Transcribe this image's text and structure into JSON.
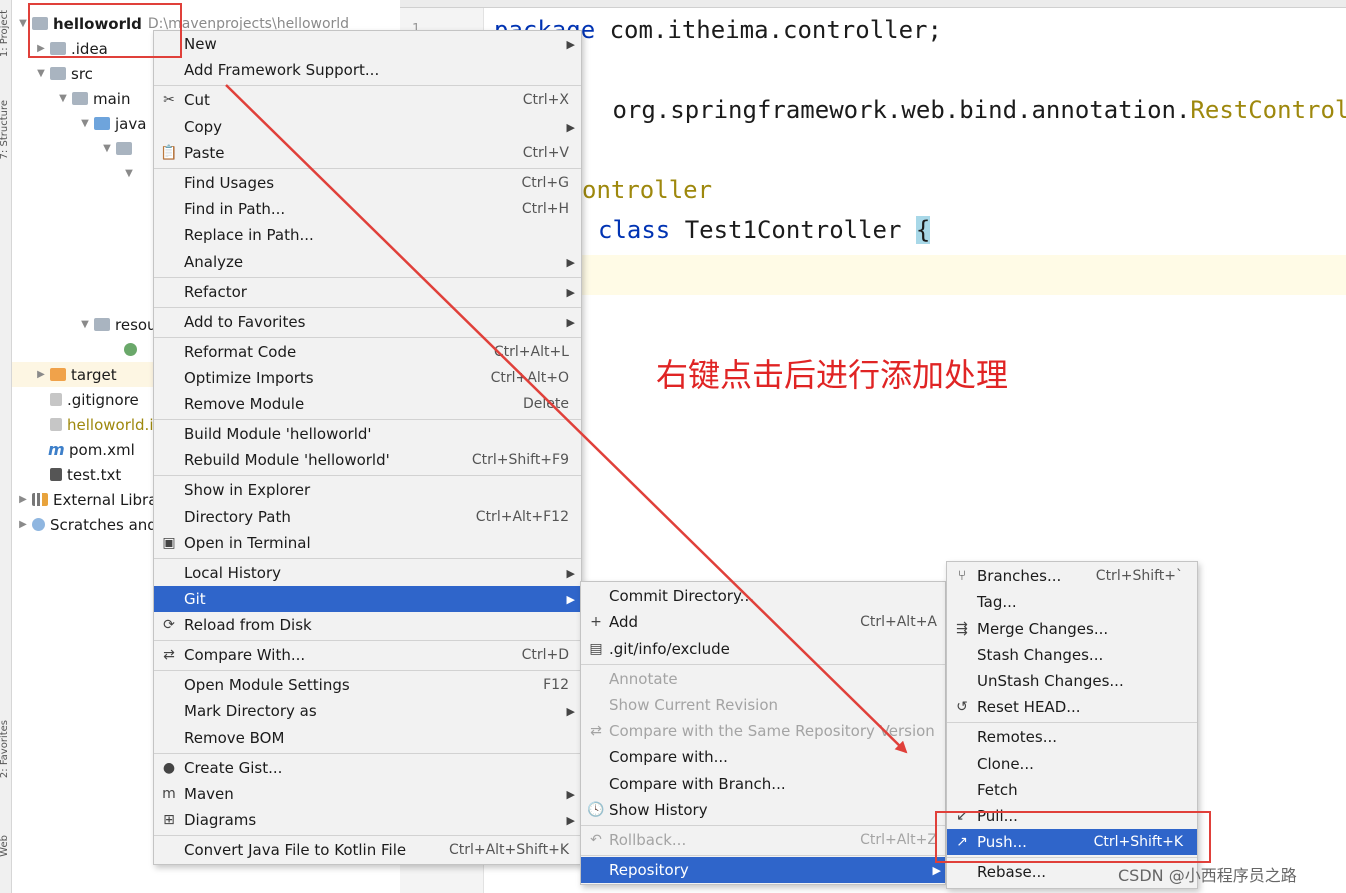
{
  "sidebar": {
    "tab_project": "1: Project",
    "tab_structure": "7: Structure",
    "tab_favorites": "2: Favorites",
    "tab_web": "Web"
  },
  "tree": {
    "root_name": "helloworld",
    "root_path": "D:\\mavenprojects\\helloworld",
    "idea": ".idea",
    "src": "src",
    "main": "main",
    "java": "java",
    "resources": "resources",
    "target": "target",
    "gitignore": ".gitignore",
    "iml": "helloworld.iml",
    "pom": "pom.xml",
    "testtxt": "test.txt",
    "external": "External Libraries",
    "scratches": "Scratches and Consoles"
  },
  "editor": {
    "line_number": "1",
    "line1_kw": "package",
    "line1_rest": " com.itheima.controller;",
    "line2_rest": " org.springframework.web.bind.annotation.",
    "line2_yellow": "RestController",
    "line3": "ontroller",
    "line4_kw": "class",
    "line4_rest": " Test1Controller ",
    "line4_brace": "{"
  },
  "annotation": "右键点击后进行添加处理",
  "context_menu": {
    "items": [
      {
        "label": "New",
        "submenu": true
      },
      {
        "label": "Add Framework Support..."
      },
      {
        "label": "Cut",
        "shortcut": "Ctrl+X",
        "icon": "✂"
      },
      {
        "label": "Copy",
        "submenu": true
      },
      {
        "label": "Paste",
        "shortcut": "Ctrl+V",
        "icon": "📋"
      },
      {
        "label": "Find Usages",
        "shortcut": "Ctrl+G"
      },
      {
        "label": "Find in Path...",
        "shortcut": "Ctrl+H"
      },
      {
        "label": "Replace in Path..."
      },
      {
        "label": "Analyze",
        "submenu": true
      },
      {
        "label": "Refactor",
        "submenu": true
      },
      {
        "label": "Add to Favorites",
        "submenu": true
      },
      {
        "label": "Reformat Code",
        "shortcut": "Ctrl+Alt+L"
      },
      {
        "label": "Optimize Imports",
        "shortcut": "Ctrl+Alt+O"
      },
      {
        "label": "Remove Module",
        "shortcut": "Delete"
      },
      {
        "label": "Build Module 'helloworld'"
      },
      {
        "label": "Rebuild Module 'helloworld'",
        "shortcut": "Ctrl+Shift+F9"
      },
      {
        "label": "Show in Explorer"
      },
      {
        "label": "Directory Path",
        "shortcut": "Ctrl+Alt+F12"
      },
      {
        "label": "Open in Terminal",
        "icon": "▣"
      },
      {
        "label": "Local History",
        "submenu": true
      },
      {
        "label": "Git",
        "submenu": true,
        "active": true
      },
      {
        "label": "Reload from Disk",
        "icon": "⟳"
      },
      {
        "label": "Compare With...",
        "shortcut": "Ctrl+D",
        "icon": "⇄"
      },
      {
        "label": "Open Module Settings",
        "shortcut": "F12"
      },
      {
        "label": "Mark Directory as",
        "submenu": true
      },
      {
        "label": "Remove BOM"
      },
      {
        "label": "Create Gist...",
        "icon": "●"
      },
      {
        "label": "Maven",
        "submenu": true,
        "icon": "m"
      },
      {
        "label": "Diagrams",
        "submenu": true,
        "icon": "⊞"
      },
      {
        "label": "Convert Java File to Kotlin File",
        "shortcut": "Ctrl+Alt+Shift+K"
      }
    ]
  },
  "git_menu": {
    "items": [
      {
        "label": "Commit Directory..."
      },
      {
        "label": "Add",
        "shortcut": "Ctrl+Alt+A",
        "icon": "+"
      },
      {
        "label": ".git/info/exclude",
        "icon": "▤"
      },
      {
        "label": "Annotate",
        "disabled": true
      },
      {
        "label": "Show Current Revision",
        "disabled": true
      },
      {
        "label": "Compare with the Same Repository Version",
        "disabled": true,
        "icon": "⇄"
      },
      {
        "label": "Compare with..."
      },
      {
        "label": "Compare with Branch..."
      },
      {
        "label": "Show History",
        "icon": "🕓"
      },
      {
        "label": "Rollback...",
        "shortcut": "Ctrl+Alt+Z",
        "disabled": true,
        "icon": "↶"
      },
      {
        "label": "Repository",
        "submenu": true,
        "active": true
      }
    ]
  },
  "repo_menu": {
    "items": [
      {
        "label": "Branches...",
        "shortcut": "Ctrl+Shift+`",
        "icon": "⑂"
      },
      {
        "label": "Tag..."
      },
      {
        "label": "Merge Changes...",
        "icon": "⇶"
      },
      {
        "label": "Stash Changes..."
      },
      {
        "label": "UnStash Changes..."
      },
      {
        "label": "Reset HEAD...",
        "icon": "↺"
      },
      {
        "label": "Remotes..."
      },
      {
        "label": "Clone..."
      },
      {
        "label": "Fetch"
      },
      {
        "label": "Pull...",
        "icon": "↙"
      },
      {
        "label": "Push...",
        "shortcut": "Ctrl+Shift+K",
        "active": true,
        "icon": "↗"
      },
      {
        "label": "Rebase..."
      }
    ]
  },
  "watermark": "CSDN @小西程序员之路",
  "colors": {
    "menu_active": "#2f65ca",
    "annotation_red": "#e02424",
    "highlight_box": "#e0403a"
  }
}
